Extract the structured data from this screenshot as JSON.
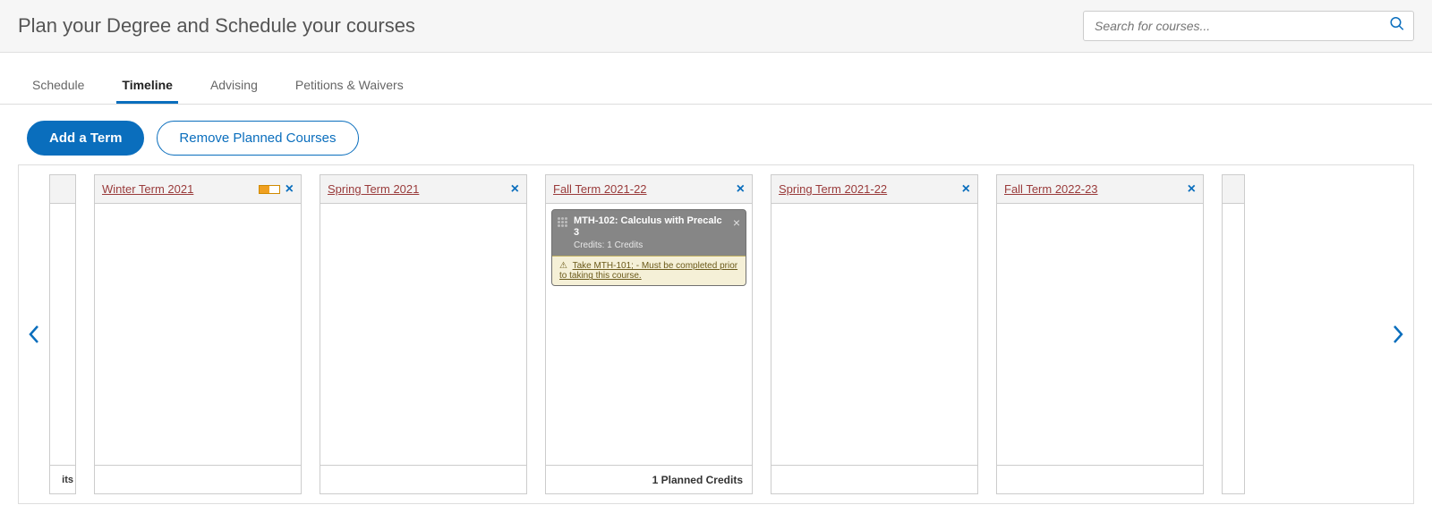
{
  "header": {
    "title": "Plan your Degree and Schedule your courses",
    "search_placeholder": "Search for courses..."
  },
  "tabs": [
    {
      "label": "Schedule",
      "active": false
    },
    {
      "label": "Timeline",
      "active": true
    },
    {
      "label": "Advising",
      "active": false
    },
    {
      "label": "Petitions & Waivers",
      "active": false
    }
  ],
  "actions": {
    "add_term": "Add a Term",
    "remove_planned": "Remove Planned Courses"
  },
  "partial_left_footer": "its",
  "terms": [
    {
      "name": "Winter Term 2021",
      "show_progress": true,
      "footer": "",
      "courses": []
    },
    {
      "name": "Spring Term 2021",
      "show_progress": false,
      "footer": "",
      "courses": []
    },
    {
      "name": "Fall Term 2021-22",
      "show_progress": false,
      "footer": "1 Planned Credits",
      "courses": [
        {
          "title": "MTH-102: Calculus with Precalc 3",
          "credits": "Credits: 1 Credits",
          "warning": "Take MTH-101; - Must be completed prior to taking this course."
        }
      ]
    },
    {
      "name": "Spring Term 2021-22",
      "show_progress": false,
      "footer": "",
      "courses": []
    },
    {
      "name": "Fall Term 2022-23",
      "show_progress": false,
      "footer": "",
      "courses": []
    }
  ]
}
